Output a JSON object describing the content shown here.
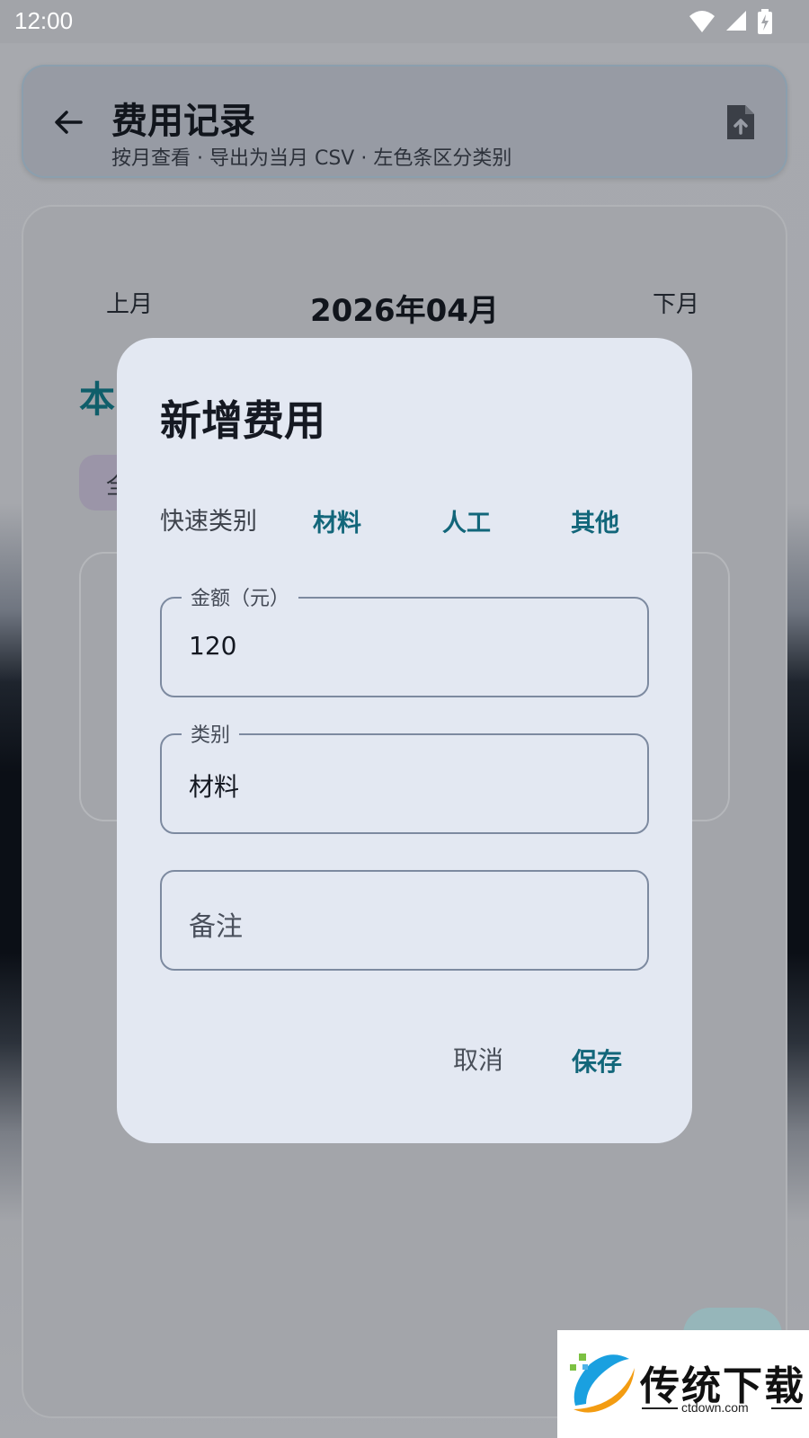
{
  "status_bar": {
    "time": "12:00"
  },
  "app_bar": {
    "title": "费用记录",
    "subtitle": "按月查看 · 导出为当月 CSV · 左色条区分类别"
  },
  "month_nav": {
    "prev_label": "上月",
    "current_month": "2026年04月",
    "next_label": "下月"
  },
  "background": {
    "heading_fragment": "本",
    "chip_fragment": "全"
  },
  "dialog": {
    "title": "新增费用",
    "quick_category_label": "快速类别",
    "quick_categories": [
      "材料",
      "人工",
      "其他"
    ],
    "amount_field": {
      "label": "金额（元）",
      "value": "120"
    },
    "category_field": {
      "label": "类别",
      "value": "材料"
    },
    "note_field": {
      "placeholder": "备注"
    },
    "cancel_label": "取消",
    "save_label": "保存"
  },
  "watermark": {
    "brand": "传统下载",
    "domain": "ctdown.com"
  },
  "colors": {
    "accent": "#12667a",
    "dialog_bg": "#e3e8f2",
    "field_border": "#7d8aa0"
  }
}
